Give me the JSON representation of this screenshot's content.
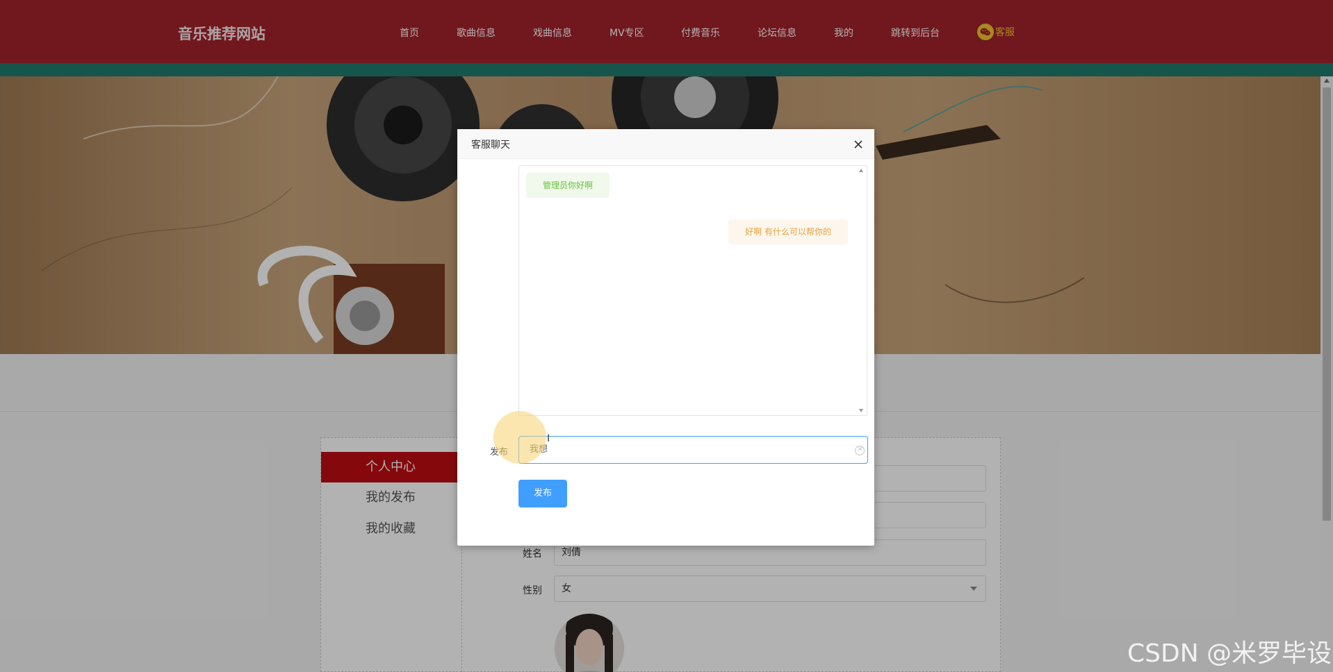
{
  "header": {
    "brand": "音乐推荐网站",
    "nav": [
      "首页",
      "歌曲信息",
      "戏曲信息",
      "MV专区",
      "付费音乐",
      "论坛信息",
      "我的",
      "跳转到后台"
    ],
    "service_label": "客服",
    "service_icon": "wechat-icon",
    "colors": {
      "bar": "#a3212c",
      "teal_strip": "#1f7a6e",
      "accent": "#f0c431"
    }
  },
  "sidebar": {
    "items": [
      {
        "label": "个人中心",
        "active": true
      },
      {
        "label": "我的发布",
        "active": false
      },
      {
        "label": "我的收藏",
        "active": false
      }
    ],
    "active_color": "#bf0c12"
  },
  "profile_form": {
    "name_label": "姓名",
    "name_value": "刘倩",
    "gender_label": "性别",
    "gender_value": "女"
  },
  "dialog": {
    "title": "客服聊天",
    "close_icon": "close-icon",
    "messages": [
      {
        "side": "left",
        "text": "管理员你好啊"
      },
      {
        "side": "right",
        "text": "好啊 有什么可以帮你的"
      }
    ],
    "input_label": "发布",
    "input_value": "我想",
    "submit_label": "发布",
    "colors": {
      "primary": "#409eff",
      "left_msg": "#67c23a",
      "right_msg": "#e6a23c"
    }
  },
  "watermark": "CSDN @米罗毕设"
}
